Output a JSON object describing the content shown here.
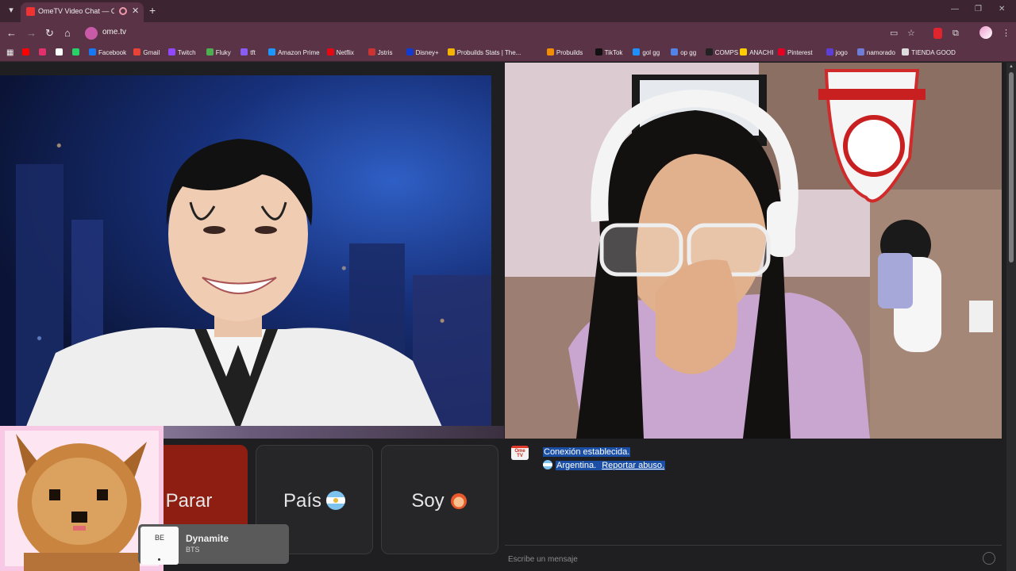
{
  "browser": {
    "tab_title": "OmeTV Video Chat — Omegle",
    "tab_close": "✕",
    "new_tab": "+",
    "url": "ome.tv",
    "win_minimize": "—",
    "win_restore": "❐",
    "win_close": "✕"
  },
  "bookmarks": [
    {
      "label": "",
      "color": "#ff0000"
    },
    {
      "label": "",
      "color": "#e1306c"
    },
    {
      "label": "",
      "color": "#ffffff"
    },
    {
      "label": "",
      "color": "#25d366"
    },
    {
      "label": "Facebook",
      "color": "#1877f2"
    },
    {
      "label": "Gmail",
      "color": "#ea4335"
    },
    {
      "label": "Twitch",
      "color": "#9146ff"
    },
    {
      "label": "Fluky",
      "color": "#4caf50"
    },
    {
      "label": "tft",
      "color": "#8a5cf6"
    },
    {
      "label": "Amazon Prime",
      "color": "#1a98ff"
    },
    {
      "label": "Netflix",
      "color": "#e50914"
    },
    {
      "label": "Jstris",
      "color": "#cc3333"
    },
    {
      "label": "Disney+",
      "color": "#113ccf"
    },
    {
      "label": "Probuilds Stats | The...",
      "color": "#f5b400"
    },
    {
      "label": "Probuilds",
      "color": "#f28c00"
    },
    {
      "label": "TikTok",
      "color": "#111111"
    },
    {
      "label": "gol gg",
      "color": "#1e90ff"
    },
    {
      "label": "op gg",
      "color": "#5383e8"
    },
    {
      "label": "COMPS",
      "color": "#222222"
    },
    {
      "label": "ANACHI",
      "color": "#ffcc00"
    },
    {
      "label": "Pinterest",
      "color": "#e60023"
    },
    {
      "label": "jogo",
      "color": "#5b3fd6"
    },
    {
      "label": "namorado",
      "color": "#6e7dd8"
    },
    {
      "label": "TIENDA GOOD",
      "color": "#dddddd"
    }
  ],
  "controls": {
    "stop_label": "Parar",
    "country_label": "País",
    "gender_label": "Soy"
  },
  "music": {
    "album_art_text": "BE",
    "title": "Dynamite",
    "artist": "BTS"
  },
  "chat": {
    "logo_text": "Ome TV",
    "status": "Conexión establecida.",
    "country": "Argentina.",
    "report_link": "Reportar abuso.",
    "placeholder": "Escribe un mensaje"
  },
  "colors": {
    "stop_button": "#8e1e12",
    "selection": "#1b4fa6",
    "chrome": "#5a3446"
  },
  "icons": [
    "tab-list-icon",
    "back-arrow-icon",
    "forward-arrow-icon",
    "reload-icon",
    "home-icon",
    "cast-icon",
    "star-icon",
    "extensions-icon",
    "profile-avatar-icon",
    "more-vert-icon",
    "apps-grid-icon",
    "emoji-icon"
  ]
}
